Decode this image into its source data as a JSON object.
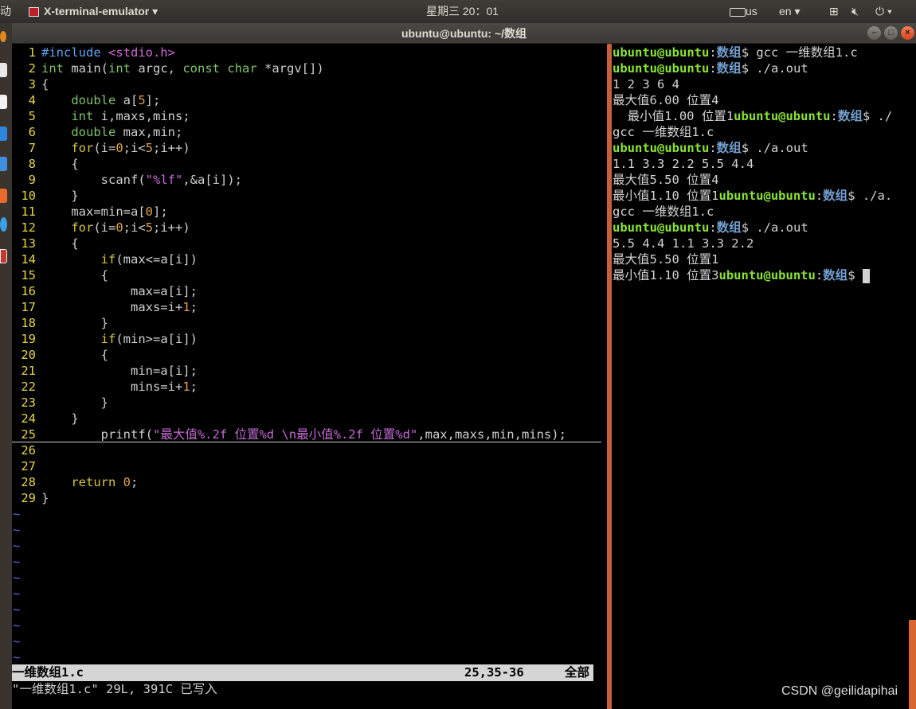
{
  "top_panel": {
    "left_cut": "动",
    "app_menu": "X-terminal-emulator",
    "clock": "星期三 20：01",
    "kbd": "us",
    "lang": "en"
  },
  "window": {
    "title": "ubuntu@ubuntu: ~/数组"
  },
  "vim": {
    "lines": [
      {
        "n": "1",
        "t": "#include <stdio.h>"
      },
      {
        "n": "2",
        "t": "int main(int argc, const char *argv[])"
      },
      {
        "n": "3",
        "t": "{"
      },
      {
        "n": "4",
        "t": "    double a[5];"
      },
      {
        "n": "5",
        "t": "    int i,maxs,mins;"
      },
      {
        "n": "6",
        "t": "    double max,min;"
      },
      {
        "n": "7",
        "t": "    for(i=0;i<5;i++)"
      },
      {
        "n": "8",
        "t": "    {"
      },
      {
        "n": "9",
        "t": "        scanf(\"%lf\",&a[i]);"
      },
      {
        "n": "10",
        "t": "    }"
      },
      {
        "n": "11",
        "t": "    max=min=a[0];"
      },
      {
        "n": "12",
        "t": "    for(i=0;i<5;i++)"
      },
      {
        "n": "13",
        "t": "    {"
      },
      {
        "n": "14",
        "t": "        if(max<=a[i])"
      },
      {
        "n": "15",
        "t": "        {"
      },
      {
        "n": "16",
        "t": "            max=a[i];"
      },
      {
        "n": "17",
        "t": "            maxs=i+1;"
      },
      {
        "n": "18",
        "t": "        }"
      },
      {
        "n": "19",
        "t": "        if(min>=a[i])"
      },
      {
        "n": "20",
        "t": "        {"
      },
      {
        "n": "21",
        "t": "            min=a[i];"
      },
      {
        "n": "22",
        "t": "            mins=i+1;"
      },
      {
        "n": "23",
        "t": "        }"
      },
      {
        "n": "24",
        "t": "    }"
      },
      {
        "n": "25",
        "t": "        printf(\"最大值%.2f 位置%d \\n最小值%.2f 位置%d\",max,maxs,min,mins);"
      },
      {
        "n": "26",
        "t": ""
      },
      {
        "n": "27",
        "t": ""
      },
      {
        "n": "28",
        "t": "    return 0;"
      },
      {
        "n": "29",
        "t": "}"
      }
    ],
    "status_file": "一维数组1.c",
    "status_pos": "25,35-36",
    "status_all": "全部",
    "message": "\"一维数组1.c\" 29L, 391C 已写入"
  },
  "terminal": {
    "user": "ubuntu@ubuntu",
    "dir": "数组",
    "lines": [
      {
        "pre": "",
        "prompt": true,
        "post": "$ gcc 一维数组1.c"
      },
      {
        "pre": "",
        "prompt": true,
        "post": "$ ./a.out"
      },
      {
        "pre": "1 2 3 6 4",
        "prompt": false,
        "post": ""
      },
      {
        "pre": "最大值6.00 位置4",
        "prompt": false,
        "post": ""
      },
      {
        "pre": "  最小值1.00 位置1",
        "prompt": true,
        "post": "$ ./"
      },
      {
        "pre": "gcc 一维数组1.c",
        "prompt": false,
        "post": ""
      },
      {
        "pre": "",
        "prompt": true,
        "post": "$ ./a.out"
      },
      {
        "pre": "1.1 3.3 2.2 5.5 4.4",
        "prompt": false,
        "post": ""
      },
      {
        "pre": "最大值5.50 位置4",
        "prompt": false,
        "post": ""
      },
      {
        "pre": "最小值1.10 位置1",
        "prompt": true,
        "post": "$ ./a."
      },
      {
        "pre": "gcc 一维数组1.c",
        "prompt": false,
        "post": ""
      },
      {
        "pre": "",
        "prompt": true,
        "post": "$ ./a.out"
      },
      {
        "pre": "5.5 4.4 1.1 3.3 2.2",
        "prompt": false,
        "post": ""
      },
      {
        "pre": "最大值5.50 位置1",
        "prompt": false,
        "post": ""
      },
      {
        "pre": "最小值1.10 位置3",
        "prompt": true,
        "post": "$ "
      }
    ]
  },
  "watermark": "CSDN @geilidapihai"
}
